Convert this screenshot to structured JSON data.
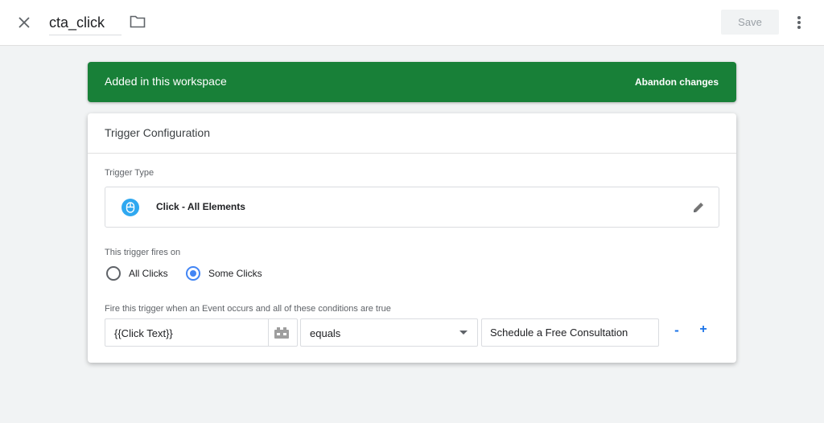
{
  "header": {
    "close_icon": "close-icon",
    "tag_name": "cta_click",
    "folder_icon": "folder-icon",
    "save_label": "Save",
    "more_icon": "more-vert-icon"
  },
  "banner": {
    "text": "Added in this workspace",
    "action_label": "Abandon changes",
    "color": "#188038"
  },
  "trigger_config": {
    "title": "Trigger Configuration",
    "type_label": "Trigger Type",
    "type_name": "Click - All Elements",
    "type_icon": "click-cursor-icon",
    "edit_icon": "pencil-icon",
    "fires_on_label": "This trigger fires on",
    "options": [
      {
        "label": "All Clicks",
        "selected": false
      },
      {
        "label": "Some Clicks",
        "selected": true
      }
    ],
    "condition_label": "Fire this trigger when an Event occurs and all of these conditions are true",
    "condition": {
      "variable": "{{Click Text}}",
      "variable_icon": "variable-picker-icon",
      "operator": "equals",
      "value": "Schedule a Free Consultation"
    },
    "remove_label": "-",
    "add_label": "+"
  },
  "colors": {
    "accent": "#4285f4",
    "link": "#1a73e8",
    "icon_blue": "#2fa8f0"
  }
}
